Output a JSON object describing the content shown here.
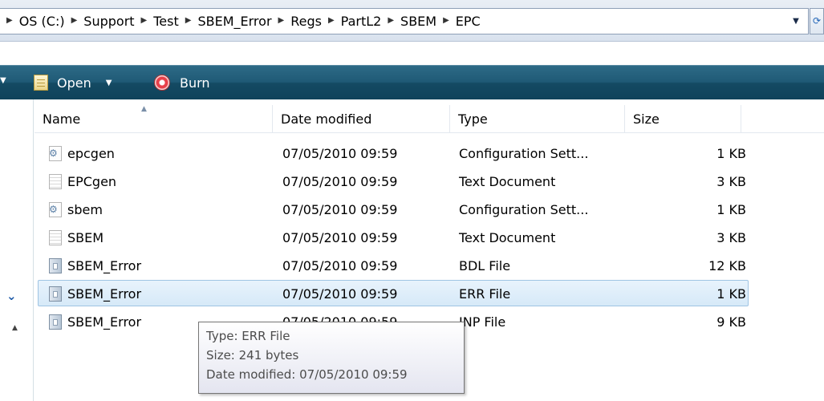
{
  "address_bar": {
    "crumbs": [
      "OS (C:)",
      "Support",
      "Test",
      "SBEM_Error",
      "Regs",
      "PartL2",
      "SBEM",
      "EPC"
    ]
  },
  "toolbar": {
    "open_label": "Open",
    "burn_label": "Burn"
  },
  "columns": {
    "name": "Name",
    "date": "Date modified",
    "type": "Type",
    "size": "Size"
  },
  "files": [
    {
      "name": "epcgen",
      "date": "07/05/2010 09:59",
      "type": "Configuration Sett...",
      "size": "1 KB",
      "icon": "config-file-icon"
    },
    {
      "name": "EPCgen",
      "date": "07/05/2010 09:59",
      "type": "Text Document",
      "size": "3 KB",
      "icon": "text-file-icon"
    },
    {
      "name": "sbem",
      "date": "07/05/2010 09:59",
      "type": "Configuration Sett...",
      "size": "1 KB",
      "icon": "config-file-icon"
    },
    {
      "name": "SBEM",
      "date": "07/05/2010 09:59",
      "type": "Text Document",
      "size": "3 KB",
      "icon": "text-file-icon"
    },
    {
      "name": "SBEM_Error",
      "date": "07/05/2010 09:59",
      "type": "BDL File",
      "size": "12 KB",
      "icon": "generic-file-icon"
    },
    {
      "name": "SBEM_Error",
      "date": "07/05/2010 09:59",
      "type": "ERR File",
      "size": "1 KB",
      "icon": "generic-file-icon",
      "selected": true
    },
    {
      "name": "SBEM_Error",
      "date": "07/05/2010 09:59",
      "type": "INP File",
      "size": "9 KB",
      "icon": "generic-file-icon"
    }
  ],
  "tooltip": {
    "type_line": "Type: ERR File",
    "size_line": "Size: 241 bytes",
    "date_line": "Date modified: 07/05/2010 09:59"
  },
  "colors": {
    "toolbar": "#1f5a76",
    "selection": "#d6e9f8",
    "selection_border": "#9fc4e3"
  }
}
